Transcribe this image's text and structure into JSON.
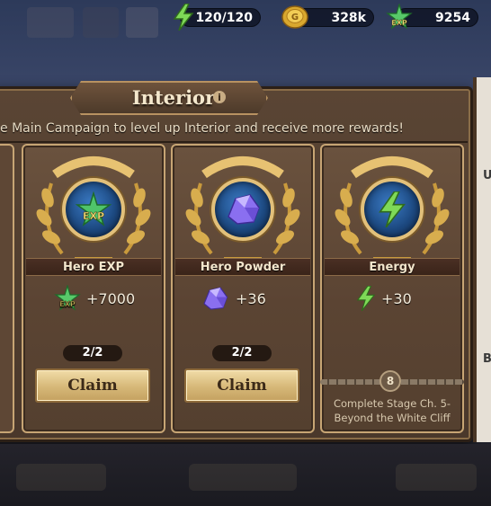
{
  "resources": {
    "energy": "120/120",
    "gold": "328k",
    "exp": "9254"
  },
  "panel": {
    "title": "Interior",
    "info_glyph": "i",
    "subtitle": "e Main Campaign to level up Interior and receive more rewards!"
  },
  "cards": [
    {
      "name": "Hero EXP",
      "icon": "exp-icon",
      "reward": "+7000",
      "progress": "2/2",
      "claim_label": "Claim"
    },
    {
      "name": "Hero Powder",
      "icon": "powder-icon",
      "reward": "+36",
      "progress": "2/2",
      "claim_label": "Claim"
    },
    {
      "name": "Energy",
      "icon": "energy-icon",
      "reward": "+30",
      "lock_level": "8",
      "requirement_line1": "Complete Stage  Ch. 5-",
      "requirement_line2": "Beyond the White Cliff"
    }
  ],
  "side_panel": {
    "letter_top": "U",
    "letter_bottom": "B"
  },
  "exp_badge": "EXP",
  "colors": {
    "panel_brown": "#5a4534",
    "gold_trim": "#c7a574",
    "claim_gold": "#d6b878",
    "medal_blue": "#1d4a82",
    "energy_green": "#7ed957"
  }
}
